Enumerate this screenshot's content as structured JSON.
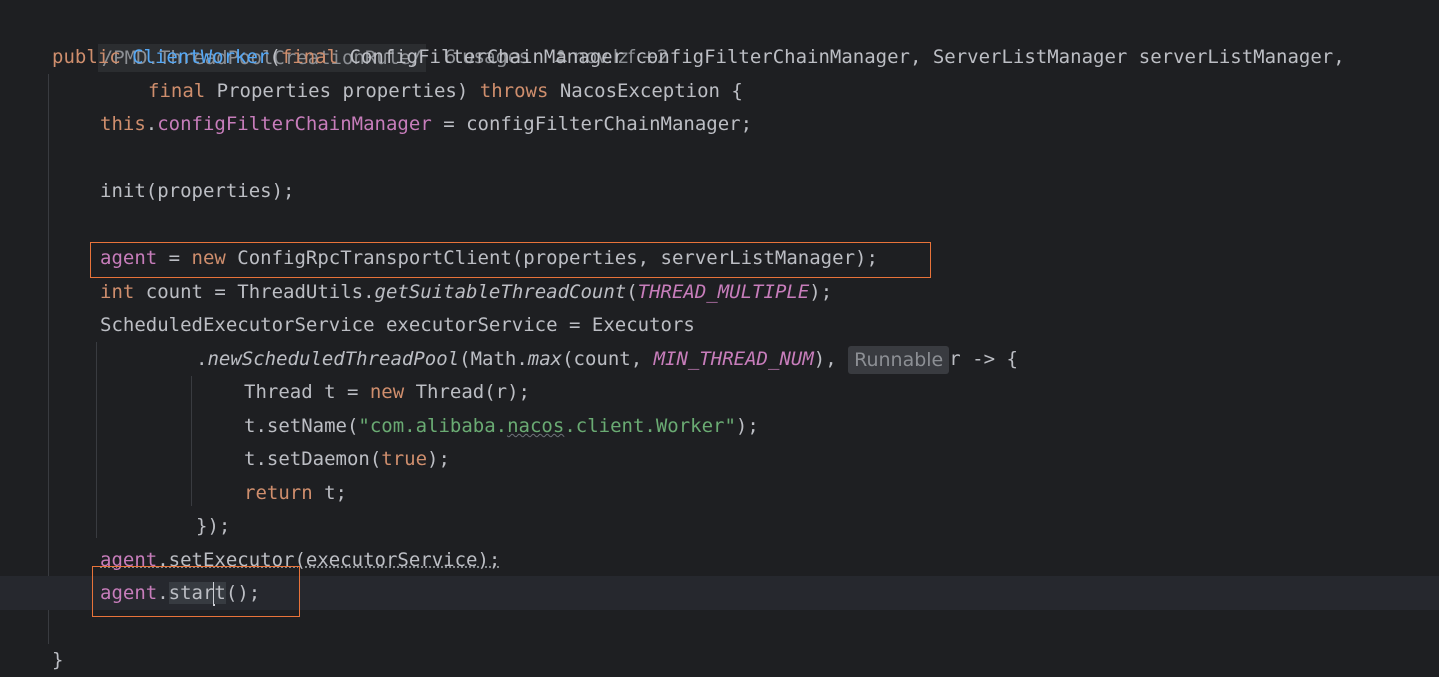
{
  "meta_line": {
    "rule_name": "/PMD.ThreadPoolCreationRule/",
    "usages": "6 usages",
    "authors": "nov.lzf +2"
  },
  "code": {
    "l1_public": "public",
    "l1_ctor": "ClientWorker",
    "l1_paren": "(",
    "l1_final": "final",
    "l1_rest": " ConfigFilterChainManager configFilterChainManager, ServerListManager serverListManager,",
    "l2_final": "final",
    "l2_mid": " Properties properties) ",
    "l2_throws": "throws",
    "l2_rest": " NacosException {",
    "l3_this": "this",
    "l3_dot": ".",
    "l3_field": "configFilterChainManager",
    "l3_rest": " = configFilterChainManager;",
    "l5": "init(properties);",
    "l7_agent": "agent",
    "l7_eq": " = ",
    "l7_new": "new",
    "l7_rest": " ConfigRpcTransportClient(properties, serverListManager);",
    "l8_int": "int",
    "l8_mid": " count = ThreadUtils.",
    "l8_method": "getSuitableThreadCount",
    "l8_open": "(",
    "l8_const": "THREAD_MULTIPLE",
    "l8_close": ");",
    "l9": "ScheduledExecutorService executorService = Executors",
    "l10_dot": ".",
    "l10_method": "newScheduledThreadPool",
    "l10_mid": "(Math.",
    "l10_max": "max",
    "l10_args": "(count, ",
    "l10_const": "MIN_THREAD_NUM",
    "l10_comma": "), ",
    "l10_hint": "Runnable",
    "l10_rest": "r -> {",
    "l11_a": "Thread t = ",
    "l11_new": "new",
    "l11_b": " Thread(r);",
    "l12_a": "t.setName(",
    "l12_s1": "\"com.alibaba.",
    "l12_s2": "nacos",
    "l12_s3": ".client.Worker\"",
    "l12_b": ");",
    "l13_a": "t.setDaemon(",
    "l13_true": "true",
    "l13_b": ");",
    "l14_return": "return",
    "l14_rest": " t;",
    "l15": "});",
    "l16_agent": "agent",
    "l16_rest": ".setExecutor(executorService);",
    "l17_agent": "agent",
    "l17_dot": ".",
    "l17_m1": "star",
    "l17_m2": "t",
    "l17_rest": "();",
    "l19": "}"
  },
  "colors": {
    "background": "#1e1f22",
    "keyword": "#cf8e6d",
    "method": "#56a8f5",
    "field": "#c77dbb",
    "string": "#6aab73",
    "highlight_box": "#e8733a"
  }
}
